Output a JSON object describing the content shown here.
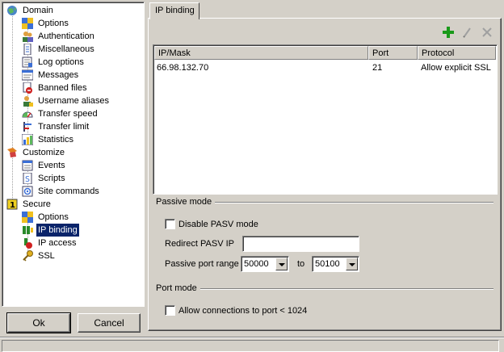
{
  "tree": {
    "domain": "Domain",
    "domain_items": [
      "Options",
      "Authentication",
      "Miscellaneous",
      "Log options",
      "Messages",
      "Banned files",
      "Username aliases",
      "Transfer speed",
      "Transfer limit",
      "Statistics"
    ],
    "customize": "Customize",
    "customize_items": [
      "Events",
      "Scripts",
      "Site commands"
    ],
    "secure": "Secure",
    "secure_items": [
      "Options",
      "IP binding",
      "IP access",
      "SSL"
    ],
    "selected": "IP binding"
  },
  "buttons": {
    "ok": "Ok",
    "cancel": "Cancel"
  },
  "tab": {
    "label": "IP binding"
  },
  "toolbar": {
    "icons": [
      "add-icon",
      "edit-icon",
      "delete-icon"
    ]
  },
  "list": {
    "columns": [
      "IP/Mask",
      "Port",
      "Protocol"
    ],
    "rows": [
      {
        "ip": "66.98.132.70",
        "port": "21",
        "protocol": "Allow explicit SSL"
      }
    ]
  },
  "passive": {
    "title": "Passive mode",
    "disable_label": "Disable PASV mode",
    "disable_checked": false,
    "redirect_label": "Redirect PASV IP",
    "redirect_value": "",
    "range_label": "Passive port range",
    "range_from": "50000",
    "to_label": "to",
    "range_to": "50100"
  },
  "port_mode": {
    "title": "Port mode",
    "allow_label": "Allow connections to port < 1024",
    "allow_checked": false
  },
  "colors": {
    "selection": "#0a246a",
    "face": "#d4d0c8",
    "add": "#1a9a1a"
  }
}
